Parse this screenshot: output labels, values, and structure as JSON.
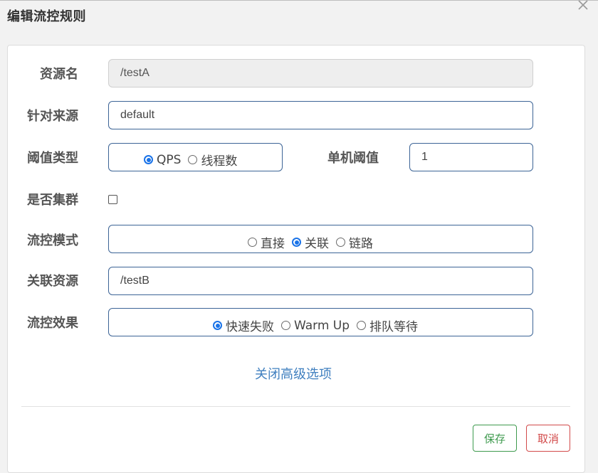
{
  "dialog": {
    "title": "编辑流控规则"
  },
  "form": {
    "resource_name": {
      "label": "资源名",
      "value": "/testA"
    },
    "limit_app": {
      "label": "针对来源",
      "value": "default"
    },
    "threshold_type": {
      "label": "阈值类型",
      "options": [
        "QPS",
        "线程数"
      ],
      "selected": "QPS"
    },
    "single_threshold": {
      "label": "单机阈值",
      "value": "1"
    },
    "cluster": {
      "label": "是否集群",
      "checked": false
    },
    "flow_mode": {
      "label": "流控模式",
      "options": [
        "直接",
        "关联",
        "链路"
      ],
      "selected": "关联"
    },
    "ref_resource": {
      "label": "关联资源",
      "value": "/testB"
    },
    "control_behavior": {
      "label": "流控效果",
      "options": [
        "快速失败",
        "Warm Up",
        "排队等待"
      ],
      "selected": "快速失败"
    }
  },
  "advanced_link": "关闭高级选项",
  "buttons": {
    "save": "保存",
    "cancel": "取消"
  },
  "colors": {
    "accent": "#1a73e8",
    "link": "#3f7fbf",
    "save": "#3e9a4e",
    "cancel": "#d24a4a",
    "input_border": "#3c6496"
  },
  "icons": {
    "close": "close-icon"
  }
}
